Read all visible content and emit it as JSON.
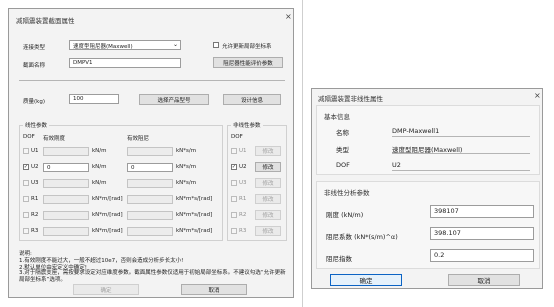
{
  "left_dialog": {
    "title": "减隔震装置截面属性",
    "close": "×",
    "connect_type_label": "连接类型",
    "connect_type_value": "速度型阻尼器(Maxwell)",
    "allow_local_coords_label": "允许更新局部坐标系",
    "section_name_label": "截面名称",
    "section_name_value": "DMPV1",
    "damper_eval_button": "阻尼器性能评价参数",
    "mass_label": "质量(kg)",
    "mass_value": "100",
    "select_product_button": "选择产品型号",
    "design_info_button": "设计信息",
    "linear_group_label": "线性参数",
    "dof_header": "DOF",
    "eff_stiffness_header": "有效刚度",
    "eff_damping_header": "有效阻尼",
    "nonlinear_group_label": "非线性参数",
    "nonlinear_dof_header": "DOF",
    "rows": [
      {
        "dof": "U1",
        "checked": false,
        "stiff": "",
        "stiff_unit": "kN/m",
        "damp": "",
        "damp_unit": "kN*s/m",
        "nl_checked": false,
        "nl_button": "修改",
        "enabled": false
      },
      {
        "dof": "U2",
        "checked": true,
        "stiff": "0",
        "stiff_unit": "kN/m",
        "damp": "0",
        "damp_unit": "kN*s/m",
        "nl_checked": true,
        "nl_button": "修改",
        "enabled": true
      },
      {
        "dof": "U3",
        "checked": false,
        "stiff": "",
        "stiff_unit": "kN/m",
        "damp": "",
        "damp_unit": "kN*s/m",
        "nl_checked": false,
        "nl_button": "修改",
        "enabled": false
      },
      {
        "dof": "R1",
        "checked": false,
        "stiff": "",
        "stiff_unit": "kN*m/[rad]",
        "damp": "",
        "damp_unit": "kN*m*s/[rad]",
        "nl_checked": false,
        "nl_button": "修改",
        "enabled": false
      },
      {
        "dof": "R2",
        "checked": false,
        "stiff": "",
        "stiff_unit": "kN*m/[rad]",
        "damp": "",
        "damp_unit": "kN*m*s/[rad]",
        "nl_checked": false,
        "nl_button": "修改",
        "enabled": false
      },
      {
        "dof": "R3",
        "checked": false,
        "stiff": "",
        "stiff_unit": "kN*m/[rad]",
        "damp": "",
        "damp_unit": "kN*m*s/[rad]",
        "nl_checked": false,
        "nl_button": "修改",
        "enabled": false
      }
    ],
    "notes_title": "说明:",
    "notes": [
      "1.有效刚度不能过大，一般不超过10e7，否则会造成分析步长太小!",
      "2.默认单位由宏定义中确定!",
      "3.对于隔震支座，需按要求设定对应维度参数。截面属性参数仅适用于初始局部坐标系。不建议勾选“允许更新局部坐标系”选项。"
    ],
    "ok_button": "确定",
    "cancel_button": "取消"
  },
  "right_dialog": {
    "title": "减隔震装置非线性属性",
    "close": "×",
    "basic_info_title": "基本信息",
    "name_label": "名称",
    "name_value": "DMP-Maxwell1",
    "type_label": "类型",
    "type_value": "速度型阻尼器(Maxwell)",
    "dof_label": "DOF",
    "dof_value": "U2",
    "nl_params_title": "非线性分析参数",
    "stiffness_label": "刚度 (kN/m)",
    "stiffness_value": "398107",
    "damping_coef_label": "阻尼系数 (kN*(s/m)^α)",
    "damping_coef_value": "398.107",
    "damping_exp_label": "阻尼指数",
    "damping_exp_value": "0.2",
    "ok_button": "确定",
    "cancel_button": "取消"
  }
}
